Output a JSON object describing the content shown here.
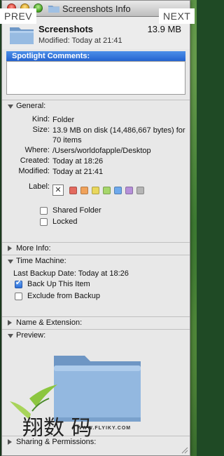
{
  "window": {
    "title": "Screenshots Info"
  },
  "header": {
    "name": "Screenshots",
    "size": "13.9 MB",
    "modified": "Modified: Today at 21:41"
  },
  "spotlight": {
    "label": "Spotlight Comments:",
    "value": ""
  },
  "nav": {
    "prev": "PREV",
    "next": "NEXT"
  },
  "general": {
    "header": "General:",
    "kind_label": "Kind:",
    "kind": "Folder",
    "size_label": "Size:",
    "size": "13.9 MB on disk (14,486,667 bytes) for 70 items",
    "where_label": "Where:",
    "where": "/Users/worldofapple/Desktop",
    "created_label": "Created:",
    "created": "Today at 18:26",
    "modified_label": "Modified:",
    "modified": "Today at 21:41",
    "label_label": "Label:",
    "label_colors": [
      "#e36a5f",
      "#f0a25b",
      "#e9d75c",
      "#a6d66b",
      "#6ea9ec",
      "#b690d9",
      "#b5b5b5"
    ],
    "shared_folder": "Shared Folder",
    "shared_folder_checked": false,
    "locked": "Locked",
    "locked_checked": false
  },
  "more_info": {
    "header": "More Info:"
  },
  "time_machine": {
    "header": "Time Machine:",
    "last_backup": "Last Backup Date: Today at 18:26",
    "back_up": "Back Up This Item",
    "back_up_checked": true,
    "exclude": "Exclude from Backup",
    "exclude_checked": false
  },
  "name_extension": {
    "header": "Name & Extension:"
  },
  "preview": {
    "header": "Preview:"
  },
  "sharing": {
    "header": "Sharing & Permissions:"
  },
  "watermark": {
    "url": "WWW.FLYIKY.COM",
    "logo_text": "翔数 码"
  }
}
